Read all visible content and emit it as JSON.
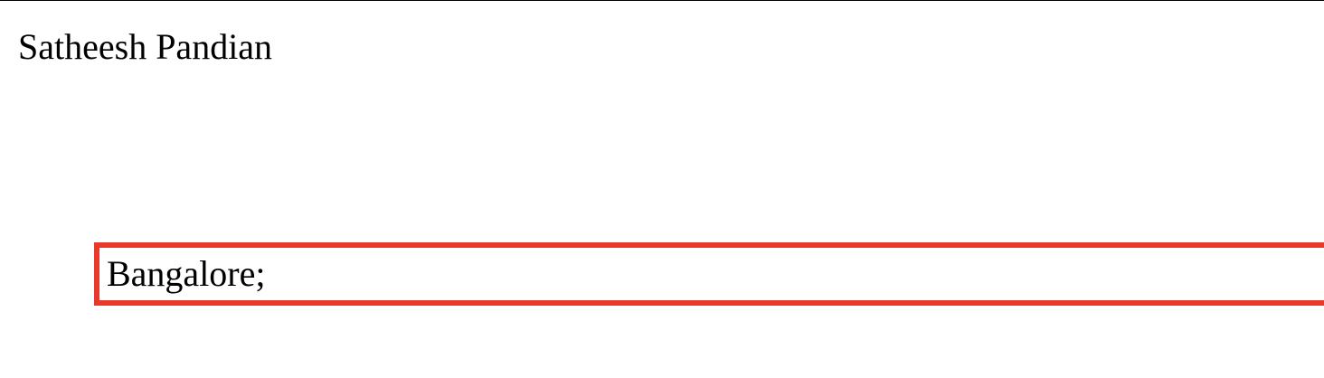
{
  "profile": {
    "name": "Satheesh Pandian",
    "location": "Bangalore;"
  },
  "colors": {
    "highlight_border": "#e8392b",
    "text": "#000000",
    "background": "#ffffff"
  }
}
